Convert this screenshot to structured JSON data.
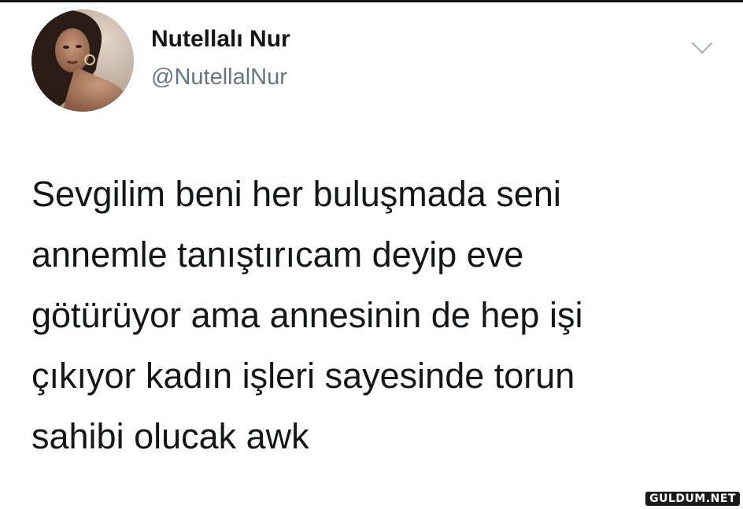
{
  "tweet": {
    "author": {
      "display_name": "Nutellalı Nur",
      "handle": "@NutellalNur",
      "avatar_icon": "profile-photo"
    },
    "menu_icon": "chevron-down-icon",
    "text_lines": [
      "Sevgilim beni her buluşmada seni",
      "annemle tanıştırıcam deyip eve",
      "götürüyor ama annesinin de hep işi",
      "çıkıyor kadın işleri sayesinde torun",
      "sahibi olucak awk"
    ]
  },
  "watermark": {
    "text": "GULDUM.NET"
  },
  "colors": {
    "text_primary": "#14171a",
    "text_secondary": "#657786",
    "chevron": "#aab8c2",
    "background": "#ffffff"
  }
}
